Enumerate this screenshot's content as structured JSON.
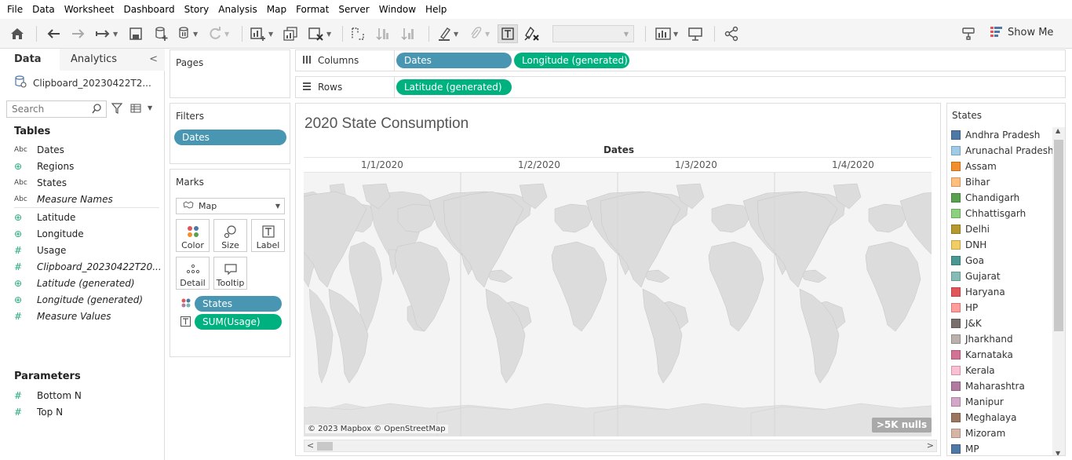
{
  "menu": [
    "File",
    "Data",
    "Worksheet",
    "Dashboard",
    "Story",
    "Analysis",
    "Map",
    "Format",
    "Server",
    "Window",
    "Help"
  ],
  "toolbar": {
    "show_me_label": "Show Me",
    "icons": [
      "home-icon",
      "undo-icon",
      "redo-icon",
      "replay-icon",
      "save-icon",
      "new-datasource-icon",
      "pause-updates-icon",
      "refresh-icon",
      "new-worksheet-icon",
      "duplicate-icon",
      "clear-sheet-icon",
      "swap-icon",
      "sort-ascending-icon",
      "sort-descending-icon",
      "highlight-icon",
      "group-icon",
      "show-labels-icon",
      "fix-axes-icon",
      "fit-dropdown",
      "show-cards-icon",
      "presentation-icon",
      "share-icon",
      "show-me-icon"
    ]
  },
  "data_pane": {
    "tab_data": "Data",
    "tab_analytics": "Analytics",
    "datasource": "Clipboard_20230422T2...",
    "search_placeholder": "Search",
    "tables_title": "Tables",
    "fields": [
      {
        "icon": "Abc",
        "kind": "abc",
        "name": "Dates",
        "italic": false
      },
      {
        "icon": "⊕",
        "kind": "geo",
        "name": "Regions",
        "italic": false
      },
      {
        "icon": "Abc",
        "kind": "abc",
        "name": "States",
        "italic": false
      },
      {
        "icon": "Abc",
        "kind": "abc",
        "name": "Measure Names",
        "italic": true
      },
      {
        "icon": "⊕",
        "kind": "geo",
        "name": "Latitude",
        "italic": false
      },
      {
        "icon": "⊕",
        "kind": "geo",
        "name": "Longitude",
        "italic": false
      },
      {
        "icon": "#",
        "kind": "num",
        "name": "Usage",
        "italic": false
      },
      {
        "icon": "#",
        "kind": "num",
        "name": "Clipboard_20230422T20...",
        "italic": true
      },
      {
        "icon": "⊕",
        "kind": "geo",
        "name": "Latitude (generated)",
        "italic": true
      },
      {
        "icon": "⊕",
        "kind": "geo",
        "name": "Longitude (generated)",
        "italic": true
      },
      {
        "icon": "#",
        "kind": "num",
        "name": "Measure Values",
        "italic": true
      }
    ],
    "parameters_title": "Parameters",
    "parameters": [
      {
        "icon": "#",
        "name": "Bottom N"
      },
      {
        "icon": "#",
        "name": "Top N"
      }
    ]
  },
  "cards": {
    "pages_title": "Pages",
    "filters_title": "Filters",
    "filter_pill": "Dates",
    "marks_title": "Marks",
    "mark_type": "Map",
    "mark_buttons": [
      "Color",
      "Size",
      "Label",
      "Detail",
      "Tooltip"
    ],
    "mark_fields": [
      {
        "prop": "color",
        "label": "States",
        "color": "blue"
      },
      {
        "prop": "label",
        "label": "SUM(Usage)",
        "color": "green"
      }
    ]
  },
  "shelves": {
    "columns_label": "Columns",
    "columns_pills": [
      {
        "label": "Dates",
        "color": "blue"
      },
      {
        "label": "Longitude (generated)",
        "color": "green"
      }
    ],
    "rows_label": "Rows",
    "rows_pills": [
      {
        "label": "Latitude (generated)",
        "color": "green"
      }
    ]
  },
  "viz": {
    "title": "2020 State Consumption",
    "dates_header": "Dates",
    "columns": [
      "1/1/2020",
      "1/2/2020",
      "1/3/2020",
      "1/4/2020"
    ],
    "attribution": "© 2023 Mapbox © OpenStreetMap",
    "nulls_badge": ">5K nulls"
  },
  "legend": {
    "title": "States",
    "items": [
      {
        "name": "Andhra Pradesh",
        "color": "#4e79a7"
      },
      {
        "name": "Arunachal Pradesh",
        "color": "#a0cbe8"
      },
      {
        "name": "Assam",
        "color": "#f28e2b"
      },
      {
        "name": "Bihar",
        "color": "#ffbe7d"
      },
      {
        "name": "Chandigarh",
        "color": "#59a14f"
      },
      {
        "name": "Chhattisgarh",
        "color": "#8cd17d"
      },
      {
        "name": "Delhi",
        "color": "#b6992d"
      },
      {
        "name": "DNH",
        "color": "#f1ce63"
      },
      {
        "name": "Goa",
        "color": "#499894"
      },
      {
        "name": "Gujarat",
        "color": "#86bcb6"
      },
      {
        "name": "Haryana",
        "color": "#e15759"
      },
      {
        "name": "HP",
        "color": "#ff9d9a"
      },
      {
        "name": "J&K",
        "color": "#79706e"
      },
      {
        "name": "Jharkhand",
        "color": "#bab0ac"
      },
      {
        "name": "Karnataka",
        "color": "#d37295"
      },
      {
        "name": "Kerala",
        "color": "#fabfd2"
      },
      {
        "name": "Maharashtra",
        "color": "#b07aa1"
      },
      {
        "name": "Manipur",
        "color": "#d4a6c8"
      },
      {
        "name": "Meghalaya",
        "color": "#9d7660"
      },
      {
        "name": "Mizoram",
        "color": "#d7b5a6"
      },
      {
        "name": "MP",
        "color": "#4e79a7"
      }
    ]
  },
  "colors": {
    "pill_blue": "#4996b2",
    "pill_green": "#00b180"
  }
}
